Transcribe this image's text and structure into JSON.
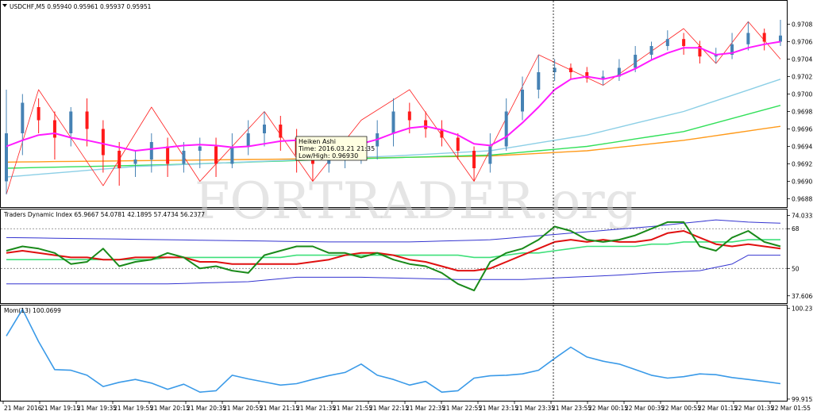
{
  "chart_data": {
    "type": "candlestick",
    "watermark": "FORTRADER.org",
    "x_ticks": [
      "21 Mar 2016",
      "21 Mar 19:15",
      "21 Mar 19:35",
      "21 Mar 19:55",
      "21 Mar 20:15",
      "21 Mar 20:35",
      "21 Mar 20:55",
      "21 Mar 21:15",
      "21 Mar 21:35",
      "21 Mar 21:55",
      "21 Mar 22:15",
      "21 Mar 22:35",
      "21 Mar 22:55",
      "21 Mar 23:15",
      "21 Mar 23:35",
      "21 Mar 23:55",
      "22 Mar 00:15",
      "22 Mar 00:35",
      "22 Mar 00:55",
      "22 Mar 01:15",
      "22 Mar 01:35",
      "22 Mar 01:55"
    ],
    "price_panel": {
      "header": "USDCHF,M5  0.95940 0.95961 0.95937 0.95951",
      "ylim": [
        0.9688,
        0.971
      ],
      "y_ticks": [
        "0.97085",
        "0.97065",
        "0.97045",
        "0.97025",
        "0.97005",
        "0.96985",
        "0.96965",
        "0.96945",
        "0.96925",
        "0.96905",
        "0.96885"
      ],
      "tooltip": {
        "title": "Heiken Ashi",
        "time": "Time: 2016.03.21 21:35",
        "lowhigh": "Low/High: 0.96930"
      },
      "candles": [
        {
          "i": 0,
          "o": 0.96905,
          "c": 0.9696,
          "l": 0.9689,
          "h": 0.9701
        },
        {
          "i": 1,
          "o": 0.9696,
          "c": 0.96995,
          "l": 0.96935,
          "h": 0.97005
        },
        {
          "i": 2,
          "o": 0.9699,
          "c": 0.96975,
          "l": 0.9696,
          "h": 0.97
        },
        {
          "i": 3,
          "o": 0.96975,
          "c": 0.96955,
          "l": 0.9693,
          "h": 0.96985
        },
        {
          "i": 4,
          "o": 0.9696,
          "c": 0.96985,
          "l": 0.96945,
          "h": 0.9699
        },
        {
          "i": 5,
          "o": 0.96985,
          "c": 0.96965,
          "l": 0.96945,
          "h": 0.97
        },
        {
          "i": 6,
          "o": 0.96965,
          "c": 0.96935,
          "l": 0.96915,
          "h": 0.96975
        },
        {
          "i": 7,
          "o": 0.9694,
          "c": 0.9692,
          "l": 0.969,
          "h": 0.9695
        },
        {
          "i": 8,
          "o": 0.96925,
          "c": 0.9693,
          "l": 0.9691,
          "h": 0.9694
        },
        {
          "i": 9,
          "o": 0.9693,
          "c": 0.9695,
          "l": 0.96915,
          "h": 0.9696
        },
        {
          "i": 10,
          "o": 0.96945,
          "c": 0.96925,
          "l": 0.9691,
          "h": 0.96955
        },
        {
          "i": 11,
          "o": 0.96925,
          "c": 0.9694,
          "l": 0.96915,
          "h": 0.9695
        },
        {
          "i": 12,
          "o": 0.9694,
          "c": 0.96945,
          "l": 0.9692,
          "h": 0.96955
        },
        {
          "i": 13,
          "o": 0.96945,
          "c": 0.96925,
          "l": 0.9691,
          "h": 0.96955
        },
        {
          "i": 14,
          "o": 0.96925,
          "c": 0.96945,
          "l": 0.9692,
          "h": 0.9696
        },
        {
          "i": 15,
          "o": 0.96945,
          "c": 0.9696,
          "l": 0.96935,
          "h": 0.96975
        },
        {
          "i": 16,
          "o": 0.9696,
          "c": 0.9697,
          "l": 0.96945,
          "h": 0.96985
        },
        {
          "i": 17,
          "o": 0.9697,
          "c": 0.96955,
          "l": 0.9694,
          "h": 0.9698
        },
        {
          "i": 18,
          "o": 0.96955,
          "c": 0.96935,
          "l": 0.96915,
          "h": 0.96965
        },
        {
          "i": 19,
          "o": 0.96935,
          "c": 0.96925,
          "l": 0.96905,
          "h": 0.96945
        },
        {
          "i": 20,
          "o": 0.96925,
          "c": 0.9693,
          "l": 0.96915,
          "h": 0.9694
        },
        {
          "i": 21,
          "o": 0.9693,
          "c": 0.9694,
          "l": 0.9692,
          "h": 0.9695
        },
        {
          "i": 22,
          "o": 0.9694,
          "c": 0.96945,
          "l": 0.96925,
          "h": 0.96955
        },
        {
          "i": 23,
          "o": 0.96945,
          "c": 0.9696,
          "l": 0.9693,
          "h": 0.96975
        },
        {
          "i": 24,
          "o": 0.9696,
          "c": 0.96985,
          "l": 0.96945,
          "h": 0.97
        },
        {
          "i": 25,
          "o": 0.96985,
          "c": 0.96975,
          "l": 0.9696,
          "h": 0.96995
        },
        {
          "i": 26,
          "o": 0.96975,
          "c": 0.96965,
          "l": 0.96955,
          "h": 0.96985
        },
        {
          "i": 27,
          "o": 0.96965,
          "c": 0.96955,
          "l": 0.96945,
          "h": 0.96975
        },
        {
          "i": 28,
          "o": 0.96955,
          "c": 0.9694,
          "l": 0.9693,
          "h": 0.9696
        },
        {
          "i": 29,
          "o": 0.9694,
          "c": 0.9692,
          "l": 0.96905,
          "h": 0.96945
        },
        {
          "i": 30,
          "o": 0.96925,
          "c": 0.96945,
          "l": 0.96915,
          "h": 0.9696
        },
        {
          "i": 31,
          "o": 0.96945,
          "c": 0.96985,
          "l": 0.9694,
          "h": 0.97
        },
        {
          "i": 32,
          "o": 0.96985,
          "c": 0.9701,
          "l": 0.96975,
          "h": 0.97025
        },
        {
          "i": 33,
          "o": 0.9701,
          "c": 0.9703,
          "l": 0.97,
          "h": 0.9705
        },
        {
          "i": 34,
          "o": 0.9703,
          "c": 0.97035,
          "l": 0.9702,
          "h": 0.97045
        },
        {
          "i": 35,
          "o": 0.97035,
          "c": 0.9703,
          "l": 0.97022,
          "h": 0.9704
        },
        {
          "i": 36,
          "o": 0.9703,
          "c": 0.97023,
          "l": 0.97018,
          "h": 0.97036
        },
        {
          "i": 37,
          "o": 0.97023,
          "c": 0.97025,
          "l": 0.97015,
          "h": 0.97032
        },
        {
          "i": 38,
          "o": 0.97025,
          "c": 0.97035,
          "l": 0.9702,
          "h": 0.97045
        },
        {
          "i": 39,
          "o": 0.97035,
          "c": 0.9705,
          "l": 0.9703,
          "h": 0.9706
        },
        {
          "i": 40,
          "o": 0.9705,
          "c": 0.9706,
          "l": 0.97045,
          "h": 0.97065
        },
        {
          "i": 41,
          "o": 0.9706,
          "c": 0.97068,
          "l": 0.97055,
          "h": 0.97078
        },
        {
          "i": 42,
          "o": 0.97068,
          "c": 0.9706,
          "l": 0.9705,
          "h": 0.97075
        },
        {
          "i": 43,
          "o": 0.9706,
          "c": 0.97048,
          "l": 0.9704,
          "h": 0.97066
        },
        {
          "i": 44,
          "o": 0.97048,
          "c": 0.9705,
          "l": 0.9704,
          "h": 0.97058
        },
        {
          "i": 45,
          "o": 0.9705,
          "c": 0.97062,
          "l": 0.97045,
          "h": 0.97075
        },
        {
          "i": 46,
          "o": 0.97062,
          "c": 0.97075,
          "l": 0.97055,
          "h": 0.97088
        },
        {
          "i": 47,
          "o": 0.97075,
          "c": 0.97065,
          "l": 0.97055,
          "h": 0.9708
        },
        {
          "i": 48,
          "o": 0.97065,
          "c": 0.97072,
          "l": 0.9706,
          "h": 0.9709
        }
      ],
      "zigzag": [
        [
          0,
          0.9689
        ],
        [
          2,
          0.9701
        ],
        [
          6,
          0.969
        ],
        [
          9,
          0.9699
        ],
        [
          12,
          0.96905
        ],
        [
          16,
          0.96985
        ],
        [
          19,
          0.96905
        ],
        [
          22,
          0.96975
        ],
        [
          25,
          0.9701
        ],
        [
          29,
          0.96905
        ],
        [
          33,
          0.9705
        ],
        [
          37,
          0.97015
        ],
        [
          42,
          0.9708
        ],
        [
          44,
          0.9704
        ],
        [
          46,
          0.97088
        ],
        [
          48,
          0.97045
        ]
      ],
      "ma_fast": [
        0.96945,
        0.96952,
        0.96958,
        0.9696,
        0.96955,
        0.96952,
        0.96948,
        0.96944,
        0.9694,
        0.96942,
        0.96944,
        0.96946,
        0.96947,
        0.96946,
        0.96944,
        0.96945,
        0.96948,
        0.96951,
        0.96952,
        0.9695,
        0.96946,
        0.96945,
        0.96948,
        0.96953,
        0.9696,
        0.96966,
        0.96968,
        0.96964,
        0.96958,
        0.96948,
        0.96946,
        0.96956,
        0.96972,
        0.9699,
        0.9701,
        0.97022,
        0.97025,
        0.97022,
        0.97026,
        0.97034,
        0.97044,
        0.97052,
        0.97058,
        0.97058,
        0.9705,
        0.97052,
        0.97058,
        0.97062,
        0.97065
      ],
      "ma_mid": [
        [
          0,
          0.9691
        ],
        [
          8,
          0.96922
        ],
        [
          16,
          0.96928
        ],
        [
          24,
          0.96934
        ],
        [
          30,
          0.9694
        ],
        [
          36,
          0.96958
        ],
        [
          42,
          0.96985
        ],
        [
          48,
          0.97022
        ]
      ],
      "ma_slow": [
        [
          0,
          0.9692
        ],
        [
          10,
          0.96924
        ],
        [
          20,
          0.9693
        ],
        [
          30,
          0.96935
        ],
        [
          36,
          0.96945
        ],
        [
          42,
          0.96962
        ],
        [
          48,
          0.96992
        ]
      ],
      "ma_orange": [
        [
          0,
          0.96927
        ],
        [
          10,
          0.96929
        ],
        [
          20,
          0.96931
        ],
        [
          30,
          0.96934
        ],
        [
          36,
          0.9694
        ],
        [
          42,
          0.96952
        ],
        [
          48,
          0.96968
        ]
      ]
    },
    "tdi_panel": {
      "header": "Traders Dynamic Index 65.9667 54.0781 42.1895 57.4734 56.2377",
      "ylim": [
        35,
        76
      ],
      "y_ticks": [
        "74.0332",
        "68",
        "50",
        "37.6066"
      ],
      "levels": [
        68,
        50
      ],
      "upper_band": [
        [
          0,
          64
        ],
        [
          10,
          63
        ],
        [
          20,
          62
        ],
        [
          25,
          62
        ],
        [
          30,
          63
        ],
        [
          35,
          66
        ],
        [
          40,
          69
        ],
        [
          44,
          72
        ],
        [
          46,
          71
        ],
        [
          48,
          70.5
        ]
      ],
      "lower_band": [
        [
          0,
          43
        ],
        [
          10,
          43
        ],
        [
          15,
          44
        ],
        [
          18,
          46
        ],
        [
          22,
          46
        ],
        [
          28,
          45
        ],
        [
          32,
          45
        ],
        [
          35,
          46
        ],
        [
          38,
          47
        ],
        [
          40,
          48
        ],
        [
          43,
          49
        ],
        [
          45,
          52
        ],
        [
          46,
          56
        ],
        [
          48,
          56
        ]
      ],
      "green_line": [
        58,
        60,
        59,
        57,
        52,
        53,
        59,
        51,
        53,
        54,
        57,
        55,
        50,
        51,
        49,
        48,
        56,
        58,
        60,
        60,
        57,
        57,
        55,
        57,
        54,
        52,
        51,
        48,
        43,
        40,
        53,
        57,
        59,
        63,
        69,
        67,
        63,
        62,
        63,
        65,
        68,
        71,
        71,
        60,
        58,
        64,
        67,
        62,
        60
      ],
      "red_line": [
        57,
        58,
        57,
        56,
        55,
        55,
        54,
        54,
        55,
        55,
        55,
        55,
        53,
        53,
        52,
        52,
        52,
        52,
        52,
        53,
        54,
        56,
        57,
        57,
        56,
        54,
        53,
        51,
        49,
        49,
        50,
        53,
        56,
        59,
        62,
        63,
        62,
        63,
        62,
        62,
        63,
        66,
        67,
        64,
        61,
        60,
        61,
        60,
        59
      ],
      "lime_line": [
        54,
        54,
        54,
        54,
        54,
        54,
        54,
        54,
        54,
        54,
        55,
        55,
        55,
        55,
        55,
        55,
        55,
        55,
        56,
        56,
        56,
        56,
        56,
        56,
        56,
        56,
        56,
        56,
        56,
        55,
        55,
        56,
        57,
        57,
        58,
        59,
        60,
        60,
        60,
        60,
        61,
        61,
        62,
        62,
        62,
        62,
        63,
        63,
        63
      ]
    },
    "mom_panel": {
      "header": "Mom(13) 100.0699",
      "ylim": [
        99.915,
        100.24
      ],
      "y_ticks": [
        "100.2379",
        "99.9152"
      ],
      "values": [
        100.14,
        100.235,
        100.12,
        100.02,
        100.018,
        100.0,
        99.96,
        99.975,
        99.985,
        99.972,
        99.95,
        99.968,
        99.94,
        99.945,
        100.0,
        99.987,
        99.976,
        99.965,
        99.97,
        99.985,
        99.999,
        100.01,
        100.04,
        100.0,
        99.985,
        99.965,
        99.978,
        99.94,
        99.945,
        99.99,
        99.998,
        100.0,
        100.005,
        100.018,
        100.06,
        100.1,
        100.065,
        100.05,
        100.04,
        100.02,
        100.0,
        99.99,
        99.995,
        100.005,
        100.002,
        99.992,
        99.985,
        99.978,
        99.97
      ]
    }
  }
}
